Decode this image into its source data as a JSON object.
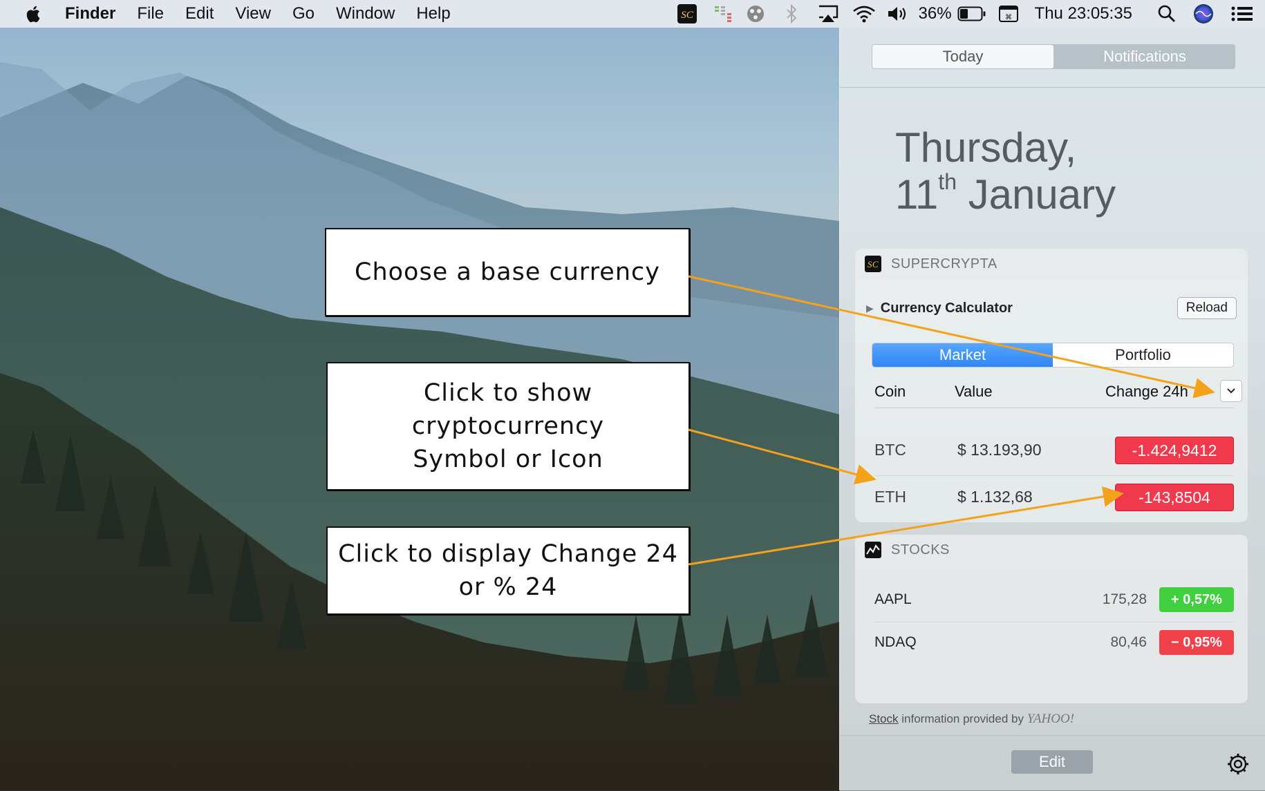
{
  "menubar": {
    "app_name": "Finder",
    "menus": [
      "File",
      "Edit",
      "View",
      "Go",
      "Window",
      "Help"
    ],
    "battery": "36%",
    "clock": "Thu 23:05:35",
    "status_icons": [
      "supercrypta-icon",
      "stocks-bar-icon",
      "dots-icon",
      "bluetooth-icon",
      "airplay-icon",
      "wifi-icon",
      "volume-icon",
      "battery-icon",
      "keyboard-icon",
      "spotlight-search-icon",
      "siri-icon",
      "notification-center-icon"
    ]
  },
  "notification_center": {
    "tabs": {
      "today": "Today",
      "notifications": "Notifications"
    },
    "date": {
      "weekday": "Thursday,",
      "day": "11",
      "suffix": "th",
      "month": "January"
    },
    "supercrypta": {
      "title": "SUPERCRYPTA",
      "calculator_label": "Currency Calculator",
      "reload_label": "Reload",
      "segments": {
        "market": "Market",
        "portfolio": "Portfolio"
      },
      "columns": {
        "coin": "Coin",
        "value": "Value",
        "change": "Change 24h"
      },
      "rows": [
        {
          "coin": "BTC",
          "value": "$ 13.193,90",
          "change": "-1.424,9412"
        },
        {
          "coin": "ETH",
          "value": "$ 1.132,68",
          "change": "-143,8504"
        }
      ]
    },
    "stocks": {
      "title": "STOCKS",
      "rows": [
        {
          "symbol": "AAPL",
          "price": "175,28",
          "change": "+ 0,57%",
          "color": "#3fcf3f"
        },
        {
          "symbol": "NDAQ",
          "price": "80,46",
          "change": "− 0,95%",
          "color": "#f0404a"
        }
      ],
      "credit_link": "Stock",
      "credit_text": " information provided by ",
      "credit_brand": "YAHOO!"
    },
    "edit_label": "Edit"
  },
  "callouts": {
    "base_currency": "Choose a base currency",
    "symbol_line1": "Click to show",
    "symbol_line2": "cryptocurrency",
    "symbol_line3": "Symbol or Icon",
    "change_line1": "Click to display Change 24",
    "change_line2": "or % 24"
  },
  "colors": {
    "accent_blue": "#2f86f6",
    "negative_red": "#f1394d",
    "positive_green": "#3fcf3f",
    "arrow_orange": "#f5a21b"
  }
}
